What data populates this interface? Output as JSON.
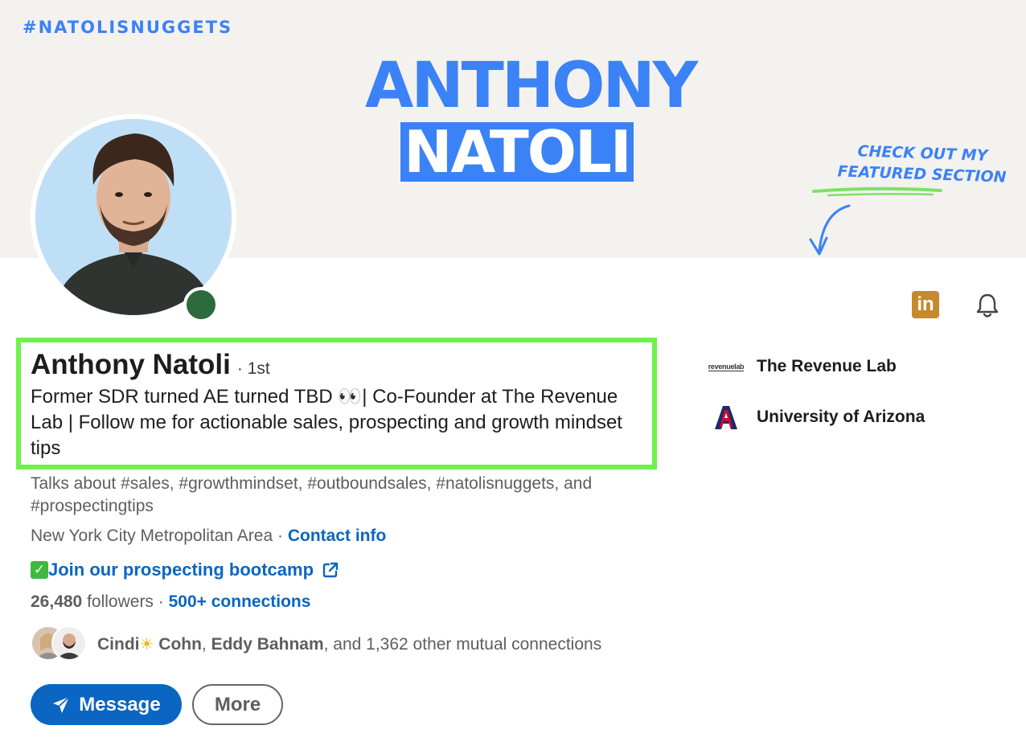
{
  "banner": {
    "hashtag": "#NATOLISNUGGETS",
    "first_name": "ANTHONY",
    "last_name": "NATOLI",
    "note_line1": "CHECK OUT MY",
    "note_line2": "FEATURED SECTION",
    "accent_color": "#3b82f6",
    "background_color": "#f4f2ee"
  },
  "profile": {
    "name": "Anthony Natoli",
    "degree": "· 1st",
    "headline": "Former SDR turned AE turned TBD 👀| Co-Founder at The Revenue Lab | Follow me for actionable sales, prospecting and growth mindset tips",
    "talks_about": "Talks about #sales, #growthmindset, #outboundsales, #natolisnuggets, and #prospectingtips",
    "location": "New York City Metropolitan Area",
    "location_sep": " · ",
    "contact_info": "Contact info",
    "custom_link": "Join our prospecting bootcamp",
    "followers_count": "26,480",
    "followers_label": " followers",
    "stats_sep": "  · ",
    "connections": "500+ connections",
    "online_status_color": "#2d6a3e",
    "highlight_color": "#6ef24a"
  },
  "mutual": {
    "first_name_a": "Cindi",
    "sun_glyph": "☀",
    "first_name_b": " Cohn",
    "separator": ", ",
    "second_name": "Eddy Bahnam",
    "rest": ", and 1,362 other mutual connections"
  },
  "actions": {
    "message_label": "Message",
    "more_label": "More",
    "primary_color": "#0a66c2"
  },
  "icons": {
    "linkedin_text": "in",
    "linkedin_color": "#c48a2c",
    "check_glyph": "✓"
  },
  "organizations": [
    {
      "name": "The Revenue Lab",
      "logo_text": "revenuelab"
    },
    {
      "name": "University of Arizona",
      "logo_text": "A"
    }
  ]
}
